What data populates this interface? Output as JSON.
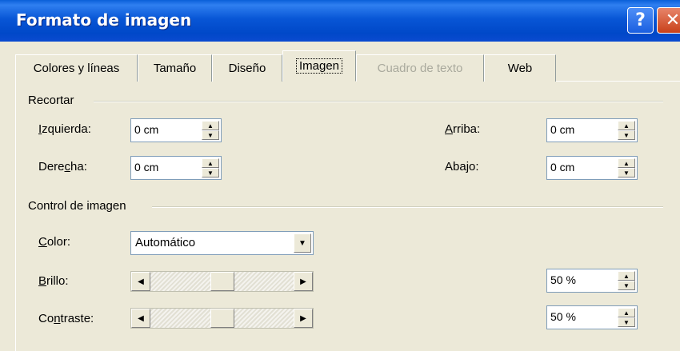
{
  "window": {
    "title": "Formato de imagen",
    "help_icon": "help-icon",
    "close_icon": "close-icon"
  },
  "tabs": [
    {
      "label": "Colores y líneas",
      "state": "normal"
    },
    {
      "label": "Tamaño",
      "state": "normal"
    },
    {
      "label": "Diseño",
      "state": "normal"
    },
    {
      "label": "Imagen",
      "state": "active"
    },
    {
      "label": "Cuadro de texto",
      "state": "disabled"
    },
    {
      "label": "Web",
      "state": "normal"
    }
  ],
  "recortar": {
    "group_label": "Recortar",
    "izquierda": {
      "label_pre": "",
      "label_key": "I",
      "label_post": "zquierda:",
      "value": "0 cm"
    },
    "derecha": {
      "label_pre": "Dere",
      "label_key": "c",
      "label_post": "ha:",
      "value": "0 cm"
    },
    "arriba": {
      "label_pre": "",
      "label_key": "A",
      "label_post": "rriba:",
      "value": "0 cm"
    },
    "abajo": {
      "label_pre": "Aba",
      "label_key": "j",
      "label_post": "o:",
      "value": "0 cm"
    }
  },
  "control": {
    "group_label": "Control de imagen",
    "color": {
      "label_pre": "",
      "label_key": "C",
      "label_post": "olor:",
      "value": "Automático"
    },
    "brillo": {
      "label_pre": "",
      "label_key": "B",
      "label_post": "rillo:",
      "value": "50 %",
      "level": 0.5
    },
    "contraste": {
      "label_pre": "Co",
      "label_key": "n",
      "label_post": "traste:",
      "value": "50 %",
      "level": 0.5
    }
  }
}
